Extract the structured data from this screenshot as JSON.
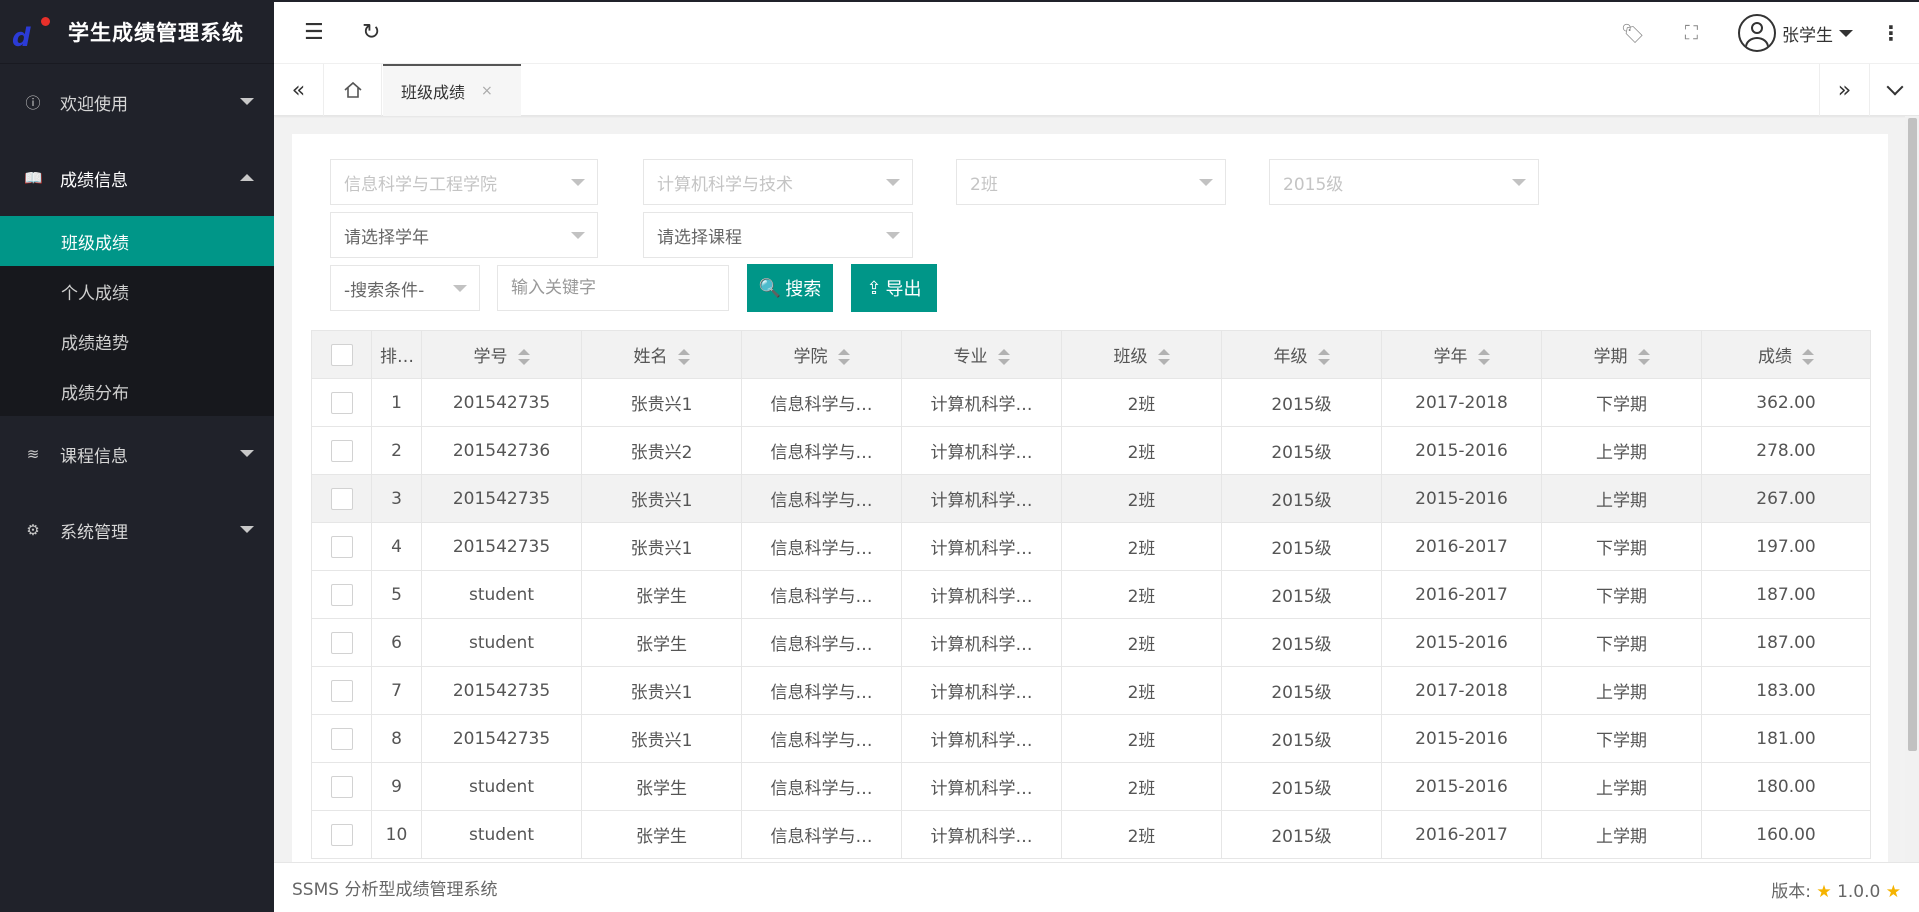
{
  "app": {
    "title": "学生成绩管理系统"
  },
  "sidebar": {
    "groups": [
      {
        "label": "欢迎使用",
        "icon": "info-circle-icon"
      },
      {
        "label": "成绩信息",
        "icon": "book-icon"
      },
      {
        "label": "课程信息",
        "icon": "layers-icon"
      },
      {
        "label": "系统管理",
        "icon": "gear-icon"
      }
    ],
    "sub_items": [
      "班级成绩",
      "个人成绩",
      "成绩趋势",
      "成绩分布"
    ]
  },
  "header": {
    "user": "张学生"
  },
  "tabs": {
    "active": "班级成绩",
    "close": "×"
  },
  "filters": {
    "college": "信息科学与工程学院",
    "major": "计算机科学与技术",
    "class": "2班",
    "grade": "2015级",
    "year_placeholder": "请选择学年",
    "course_placeholder": "请选择课程",
    "condition": "-搜索条件-",
    "keyword_placeholder": "输入关键字",
    "search_label": "搜索",
    "export_label": "导出"
  },
  "table": {
    "columns": [
      "排名",
      "学号",
      "姓名",
      "学院",
      "专业",
      "班级",
      "年级",
      "学年",
      "学期",
      "成绩"
    ],
    "rows": [
      [
        "1",
        "201542735",
        "张贵兴1",
        "信息科学与…",
        "计算机科学…",
        "2班",
        "2015级",
        "2017-2018",
        "下学期",
        "362.00"
      ],
      [
        "2",
        "201542736",
        "张贵兴2",
        "信息科学与…",
        "计算机科学…",
        "2班",
        "2015级",
        "2015-2016",
        "上学期",
        "278.00"
      ],
      [
        "3",
        "201542735",
        "张贵兴1",
        "信息科学与…",
        "计算机科学…",
        "2班",
        "2015级",
        "2015-2016",
        "上学期",
        "267.00"
      ],
      [
        "4",
        "201542735",
        "张贵兴1",
        "信息科学与…",
        "计算机科学…",
        "2班",
        "2015级",
        "2016-2017",
        "下学期",
        "197.00"
      ],
      [
        "5",
        "student",
        "张学生",
        "信息科学与…",
        "计算机科学…",
        "2班",
        "2015级",
        "2016-2017",
        "下学期",
        "187.00"
      ],
      [
        "6",
        "student",
        "张学生",
        "信息科学与…",
        "计算机科学…",
        "2班",
        "2015级",
        "2015-2016",
        "下学期",
        "187.00"
      ],
      [
        "7",
        "201542735",
        "张贵兴1",
        "信息科学与…",
        "计算机科学…",
        "2班",
        "2015级",
        "2017-2018",
        "上学期",
        "183.00"
      ],
      [
        "8",
        "201542735",
        "张贵兴1",
        "信息科学与…",
        "计算机科学…",
        "2班",
        "2015级",
        "2015-2016",
        "下学期",
        "181.00"
      ],
      [
        "9",
        "student",
        "张学生",
        "信息科学与…",
        "计算机科学…",
        "2班",
        "2015级",
        "2015-2016",
        "上学期",
        "180.00"
      ],
      [
        "10",
        "student",
        "张学生",
        "信息科学与…",
        "计算机科学…",
        "2班",
        "2015级",
        "2016-2017",
        "上学期",
        "160.00"
      ]
    ]
  },
  "footer": {
    "left": "SSMS 分析型成绩管理系统",
    "version_label": "版本:",
    "version": "1.0.0"
  },
  "colors": {
    "accent": "#009688",
    "sidebar_bg": "#20222a"
  }
}
